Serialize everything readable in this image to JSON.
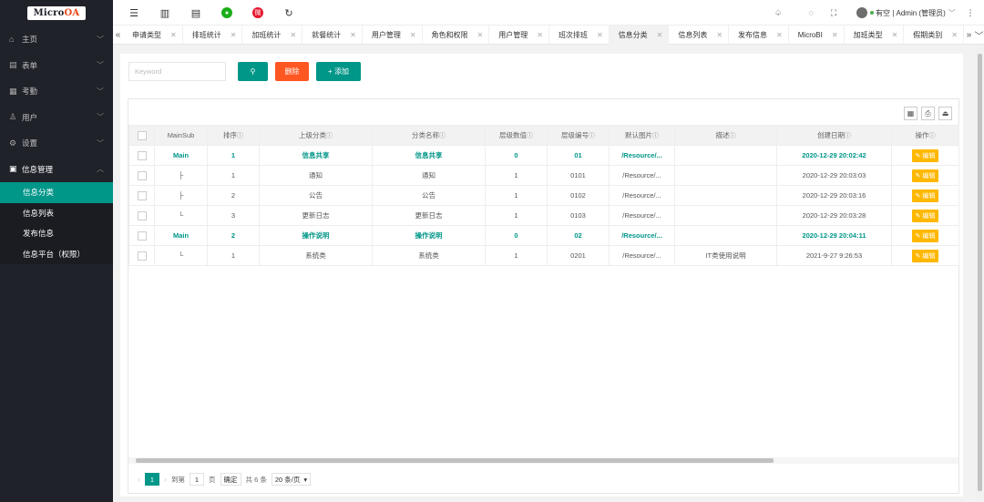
{
  "app": {
    "logo_text_a": "Micro",
    "logo_text_b": "OA"
  },
  "sidebar": {
    "items": [
      {
        "icon": "⌂",
        "label": "主页"
      },
      {
        "icon": "▤",
        "label": "表单"
      },
      {
        "icon": "▦",
        "label": "考勤"
      },
      {
        "icon": "♙",
        "label": "用户"
      },
      {
        "icon": "⚙",
        "label": "设置"
      },
      {
        "icon": "▣",
        "label": "信息管理"
      }
    ],
    "subitems": [
      {
        "label": "信息分类"
      },
      {
        "label": "信息列表"
      },
      {
        "label": "发布信息"
      },
      {
        "label": "信息平台（权限）"
      }
    ]
  },
  "header": {
    "user_text": "有空 | Admin (管理员)",
    "weibo_glyph": "微"
  },
  "tabs": [
    "申请类型",
    "排班统计",
    "加班统计",
    "就餐统计",
    "用户管理",
    "角色和权限",
    "用户管理",
    "班次排班",
    "信息分类",
    "信息列表",
    "发布信息",
    "MicroBI",
    "加班类型",
    "假期类别"
  ],
  "search": {
    "placeholder": "Keyword",
    "delete_label": "删除",
    "add_label": "+ 添加"
  },
  "table": {
    "headers": [
      "MainSub",
      "排序",
      "上级分类",
      "分类名称",
      "层级数值",
      "层级编号",
      "默认图片",
      "描述",
      "创建日期",
      "操作"
    ],
    "rows": [
      [
        "Main",
        "1",
        "信息共享",
        "信息共享",
        "0",
        "01",
        "/Resource/...",
        "",
        "2020-12-29 20:02:42"
      ],
      [
        "├",
        "1",
        "通知",
        "通知",
        "1",
        "0101",
        "/Resource/...",
        "",
        "2020-12-29 20:03:03"
      ],
      [
        "├",
        "2",
        "公告",
        "公告",
        "1",
        "0102",
        "/Resource/...",
        "",
        "2020-12-29 20:03:16"
      ],
      [
        "└",
        "3",
        "更新日志",
        "更新日志",
        "1",
        "0103",
        "/Resource/...",
        "",
        "2020-12-29 20:03:28"
      ],
      [
        "Main",
        "2",
        "操作说明",
        "操作说明",
        "0",
        "02",
        "/Resource/...",
        "",
        "2020-12-29 20:04:11"
      ],
      [
        "└",
        "1",
        "系统类",
        "系统类",
        "1",
        "0201",
        "/Resource/...",
        "IT类使用说明",
        "2021-9-27 9:26:53"
      ]
    ],
    "edit_label": "编辑"
  },
  "pager": {
    "current": "1",
    "goto_label": "到第",
    "goto_value": "1",
    "page_label": "页",
    "confirm_label": "确定",
    "total_label": "共 6 条",
    "page_size": "20 条/页"
  },
  "colors": {
    "accent": "#009688",
    "danger": "#ff5722",
    "warn": "#ffb800",
    "sidebar": "#20222a"
  }
}
